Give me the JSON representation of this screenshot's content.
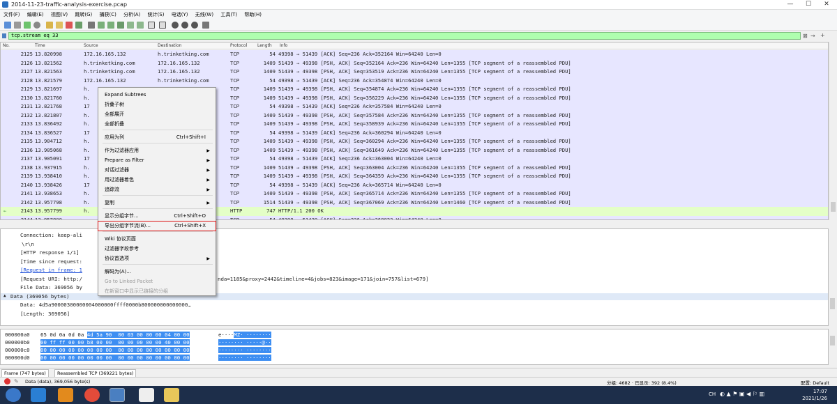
{
  "window": {
    "title": "2014-11-23-traffic-analysis-exercise.pcap"
  },
  "menubar": {
    "items": [
      "文件(F)",
      "编辑(E)",
      "视图(V)",
      "跳转(G)",
      "捕获(C)",
      "分析(A)",
      "统计(S)",
      "电话(Y)",
      "无线(W)",
      "工具(T)",
      "帮助(H)"
    ]
  },
  "filter": {
    "value": "tcp.stream eq 33"
  },
  "packet_list": {
    "headers": [
      "No.",
      "Time",
      "Source",
      "Destination",
      "Protocol",
      "Length",
      "Info"
    ],
    "rows": [
      {
        "no": "2125",
        "time": "13.820998",
        "src": "172.16.165.132",
        "dst": "h.trinketking.com",
        "proto": "TCP",
        "len": "54",
        "info": "49398 → 51439 [ACK] Seq=236 Ack=352164 Win=64240 Len=0"
      },
      {
        "no": "2126",
        "time": "13.821562",
        "src": "h.trinketking.com",
        "dst": "172.16.165.132",
        "proto": "TCP",
        "len": "1409",
        "info": "51439 → 49398 [PSH, ACK] Seq=352164 Ack=236 Win=64240 Len=1355 [TCP segment of a reassembled PDU]"
      },
      {
        "no": "2127",
        "time": "13.821563",
        "src": "h.trinketking.com",
        "dst": "172.16.165.132",
        "proto": "TCP",
        "len": "1409",
        "info": "51439 → 49398 [PSH, ACK] Seq=353519 Ack=236 Win=64240 Len=1355 [TCP segment of a reassembled PDU]"
      },
      {
        "no": "2128",
        "time": "13.821579",
        "src": "172.16.165.132",
        "dst": "h.trinketking.com",
        "proto": "TCP",
        "len": "54",
        "info": "49398 → 51439 [ACK] Seq=236 Ack=354874 Win=64240 Len=0"
      },
      {
        "no": "2129",
        "time": "13.821697",
        "src": "h.",
        "dst": "",
        "proto": "TCP",
        "len": "1409",
        "info": "51439 → 49398 [PSH, ACK] Seq=354874 Ack=236 Win=64240 Len=1355 [TCP segment of a reassembled PDU]"
      },
      {
        "no": "2130",
        "time": "13.821760",
        "src": "h.",
        "dst": "",
        "proto": "TCP",
        "len": "1409",
        "info": "51439 → 49398 [PSH, ACK] Seq=356229 Ack=236 Win=64240 Len=1355 [TCP segment of a reassembled PDU]"
      },
      {
        "no": "2131",
        "time": "13.821768",
        "src": "17",
        "dst": "",
        "proto": "TCP",
        "len": "54",
        "info": "49398 → 51439 [ACK] Seq=236 Ack=357584 Win=64240 Len=0"
      },
      {
        "no": "2132",
        "time": "13.821807",
        "src": "h.",
        "dst": "",
        "proto": "TCP",
        "len": "1409",
        "info": "51439 → 49398 [PSH, ACK] Seq=357584 Ack=236 Win=64240 Len=1355 [TCP segment of a reassembled PDU]"
      },
      {
        "no": "2133",
        "time": "13.836492",
        "src": "h.",
        "dst": "",
        "proto": "TCP",
        "len": "1409",
        "info": "51439 → 49398 [PSH, ACK] Seq=358939 Ack=236 Win=64240 Len=1355 [TCP segment of a reassembled PDU]"
      },
      {
        "no": "2134",
        "time": "13.836527",
        "src": "17",
        "dst": "",
        "proto": "TCP",
        "len": "54",
        "info": "49398 → 51439 [ACK] Seq=236 Ack=360294 Win=64240 Len=0"
      },
      {
        "no": "2135",
        "time": "13.904712",
        "src": "h.",
        "dst": "",
        "proto": "TCP",
        "len": "1409",
        "info": "51439 → 49398 [PSH, ACK] Seq=360294 Ack=236 Win=64240 Len=1355 [TCP segment of a reassembled PDU]"
      },
      {
        "no": "2136",
        "time": "13.905068",
        "src": "h.",
        "dst": "",
        "proto": "TCP",
        "len": "1409",
        "info": "51439 → 49398 [PSH, ACK] Seq=361649 Ack=236 Win=64240 Len=1355 [TCP segment of a reassembled PDU]"
      },
      {
        "no": "2137",
        "time": "13.905091",
        "src": "17",
        "dst": "",
        "proto": "TCP",
        "len": "54",
        "info": "49398 → 51439 [ACK] Seq=236 Ack=363004 Win=64240 Len=0"
      },
      {
        "no": "2138",
        "time": "13.937915",
        "src": "h.",
        "dst": "",
        "proto": "TCP",
        "len": "1409",
        "info": "51439 → 49398 [PSH, ACK] Seq=363004 Ack=236 Win=64240 Len=1355 [TCP segment of a reassembled PDU]"
      },
      {
        "no": "2139",
        "time": "13.938410",
        "src": "h.",
        "dst": "",
        "proto": "TCP",
        "len": "1409",
        "info": "51439 → 49398 [PSH, ACK] Seq=364359 Ack=236 Win=64240 Len=1355 [TCP segment of a reassembled PDU]"
      },
      {
        "no": "2140",
        "time": "13.938426",
        "src": "17",
        "dst": "",
        "proto": "TCP",
        "len": "54",
        "info": "49398 → 51439 [ACK] Seq=236 Ack=365714 Win=64240 Len=0"
      },
      {
        "no": "2141",
        "time": "13.938653",
        "src": "h.",
        "dst": "",
        "proto": "TCP",
        "len": "1409",
        "info": "51439 → 49398 [PSH, ACK] Seq=365714 Ack=236 Win=64240 Len=1355 [TCP segment of a reassembled PDU]"
      },
      {
        "no": "2142",
        "time": "13.957798",
        "src": "h.",
        "dst": "",
        "proto": "TCP",
        "len": "1514",
        "info": "51439 → 49398 [PSH, ACK] Seq=367069 Ack=236 Win=64240 Len=1460 [TCP segment of a reassembled PDU]"
      },
      {
        "no": "2143",
        "time": "13.957799",
        "src": "h.",
        "dst": "",
        "proto": "HTTP",
        "len": "747",
        "info": "HTTP/1.1 200 OK"
      },
      {
        "no": "2144",
        "time": "13.957800",
        "src": "",
        "dst": "",
        "proto": "TCP",
        "len": "54",
        "info": "49398 → 51439 [ACK] Seq=236 Ack=368023 Win=64240 Len=0"
      }
    ]
  },
  "detail": {
    "lines": [
      "Connection: keep-ali",
      "\\r\\n",
      "[HTTP response 1/1]",
      "[Time since request:",
      "[Request in frame: 1",
      "[Request URI: http:/",
      "File Data: 369056 by"
    ],
    "request_uri_tail": "nda=1185&proxy=2442&timeline=4&jobs=823&image=171&join=757&list=679]",
    "data_header": "Data (369056 bytes)",
    "data_value": "Data: 4d5a90000300000004000000ffff0000b800000000000000…",
    "data_length": "[Length: 369056]"
  },
  "bytes": {
    "rows": [
      {
        "offset": "000000a0",
        "hex_plain": "65 0d 0a 0d 0a ",
        "hex_hl": "4d 5a 90  00 03 00 00 00 04 00 00",
        "ascii_plain": "e····",
        "ascii_hl": "MZ· ········"
      },
      {
        "offset": "000000b0",
        "hex_plain": "",
        "hex_hl": "00 ff ff 00 00 b8 00 00  00 00 00 00 00 40 00 00",
        "ascii_plain": "",
        "ascii_hl": "········ ·····@··"
      },
      {
        "offset": "000000c0",
        "hex_plain": "",
        "hex_hl": "00 00 00 00 00 00 00 00  00 00 00 00 00 00 00 00",
        "ascii_plain": "",
        "ascii_hl": "········ ········"
      },
      {
        "offset": "000000d0",
        "hex_plain": "",
        "hex_hl": "00 00 00 00 00 00 00 00  00 00 00 00 00 00 00 00",
        "ascii_plain": "",
        "ascii_hl": "········ ········"
      }
    ],
    "tabs": [
      "Frame (747 bytes)",
      "Reassembled TCP (369221 bytes)"
    ]
  },
  "status": {
    "left": "Data (data), 369,056 byte(s)",
    "packets": "分组: 4682 · 已显示: 392 (8.4%)",
    "profile": "配置: Default"
  },
  "context_menu": {
    "items": [
      {
        "label": "Expand Subtrees",
        "shortcut": "",
        "arrow": false
      },
      {
        "label": "折叠子树",
        "shortcut": "",
        "arrow": false
      },
      {
        "label": "全部展开",
        "shortcut": "",
        "arrow": false
      },
      {
        "label": "全部折叠",
        "shortcut": "",
        "arrow": false
      },
      {
        "label": "应用为列",
        "shortcut": "Ctrl+Shift+I",
        "arrow": false
      },
      {
        "label": "作为过滤器应用",
        "shortcut": "",
        "arrow": true
      },
      {
        "label": "Prepare as Filter",
        "shortcut": "",
        "arrow": true
      },
      {
        "label": "对话过滤器",
        "shortcut": "",
        "arrow": true
      },
      {
        "label": "用过滤器着色",
        "shortcut": "",
        "arrow": true
      },
      {
        "label": "追踪流",
        "shortcut": "",
        "arrow": true
      },
      {
        "label": "复制",
        "shortcut": "",
        "arrow": true
      },
      {
        "label": "显示分组字节...",
        "shortcut": "Ctrl+Shift+O",
        "arrow": false
      },
      {
        "label": "导出分组字节流(B)...",
        "shortcut": "Ctrl+Shift+X",
        "arrow": false
      },
      {
        "label": "Wiki 协议页面",
        "shortcut": "",
        "arrow": false
      },
      {
        "label": "过滤器字段参考",
        "shortcut": "",
        "arrow": false
      },
      {
        "label": "协议首选项",
        "shortcut": "",
        "arrow": true
      },
      {
        "label": "解码为(A)...",
        "shortcut": "",
        "arrow": false
      },
      {
        "label": "Go to Linked Packet",
        "shortcut": "",
        "arrow": false
      },
      {
        "label": "在新窗口中显示已链接的分组",
        "shortcut": "",
        "arrow": false
      }
    ]
  },
  "taskbar": {
    "time": "17:07",
    "date": "2021/1/26"
  }
}
